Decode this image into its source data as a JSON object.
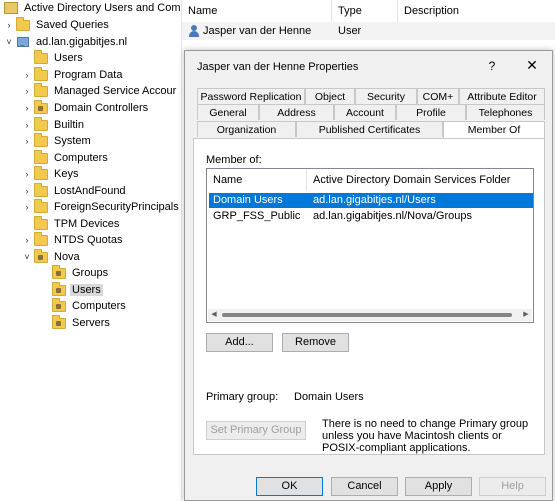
{
  "tree": {
    "items": [
      {
        "label": "Active Directory Users and Com",
        "chevron": "",
        "icon": "root-icon"
      },
      {
        "label": "Saved Queries",
        "chevron": "›",
        "icon": "folder-icon"
      },
      {
        "label": "ad.lan.gigabitjes.nl",
        "chevron": "˅",
        "icon": "domain-icon"
      },
      {
        "label": "Users",
        "chevron": "",
        "icon": "folder-icon"
      },
      {
        "label": "Program Data",
        "chevron": "›",
        "icon": "folder-icon"
      },
      {
        "label": "Managed Service Accour",
        "chevron": "›",
        "icon": "folder-icon"
      },
      {
        "label": "Domain Controllers",
        "chevron": "›",
        "icon": "ou-folder-icon"
      },
      {
        "label": "Builtin",
        "chevron": "›",
        "icon": "folder-icon"
      },
      {
        "label": "System",
        "chevron": "›",
        "icon": "folder-icon"
      },
      {
        "label": "Computers",
        "chevron": "",
        "icon": "folder-icon"
      },
      {
        "label": "Keys",
        "chevron": "›",
        "icon": "folder-icon"
      },
      {
        "label": "LostAndFound",
        "chevron": "›",
        "icon": "folder-icon"
      },
      {
        "label": "ForeignSecurityPrincipals",
        "chevron": "›",
        "icon": "folder-icon"
      },
      {
        "label": "TPM Devices",
        "chevron": "",
        "icon": "folder-icon"
      },
      {
        "label": "NTDS Quotas",
        "chevron": "›",
        "icon": "folder-icon"
      },
      {
        "label": "Nova",
        "chevron": "˅",
        "icon": "ou-folder-icon"
      },
      {
        "label": "Groups",
        "chevron": "",
        "icon": "ou-folder-icon"
      },
      {
        "label": "Users",
        "chevron": "",
        "icon": "ou-folder-icon"
      },
      {
        "label": "Computers",
        "chevron": "",
        "icon": "ou-folder-icon"
      },
      {
        "label": "Servers",
        "chevron": "",
        "icon": "ou-folder-icon"
      }
    ]
  },
  "list": {
    "columns": [
      "Name",
      "Type",
      "Description"
    ],
    "rows": [
      {
        "name": "Jasper van der Henne",
        "type": "User",
        "description": ""
      }
    ]
  },
  "dialog": {
    "title": "Jasper van der Henne Properties",
    "help": "?",
    "close": "✕",
    "tabs_row1": [
      "Password Replication",
      "Object",
      "Security",
      "COM+",
      "Attribute Editor"
    ],
    "tabs_row2": [
      "General",
      "Address",
      "Account",
      "Profile",
      "Telephones"
    ],
    "tabs_row3": [
      "Organization",
      "Published Certificates",
      "Member Of"
    ],
    "active_tab": "Member Of",
    "member_of_label": "Member of:",
    "columns": [
      "Name",
      "Active Directory Domain Services Folder"
    ],
    "members": [
      {
        "name": "Domain Users",
        "folder": "ad.lan.gigabitjes.nl/Users"
      },
      {
        "name": "GRP_FSS_Public",
        "folder": "ad.lan.gigabitjes.nl/Nova/Groups"
      }
    ],
    "add_label": "Add...",
    "remove_label": "Remove",
    "primary_group_label": "Primary group:",
    "primary_group_value": "Domain Users",
    "set_primary_label": "Set Primary Group",
    "note": "There is no need to change Primary group unless you have Macintosh clients or POSIX-compliant applications.",
    "ok_label": "OK",
    "cancel_label": "Cancel",
    "apply_label": "Apply",
    "help_label": "Help",
    "selection_color": "#0078d7"
  }
}
